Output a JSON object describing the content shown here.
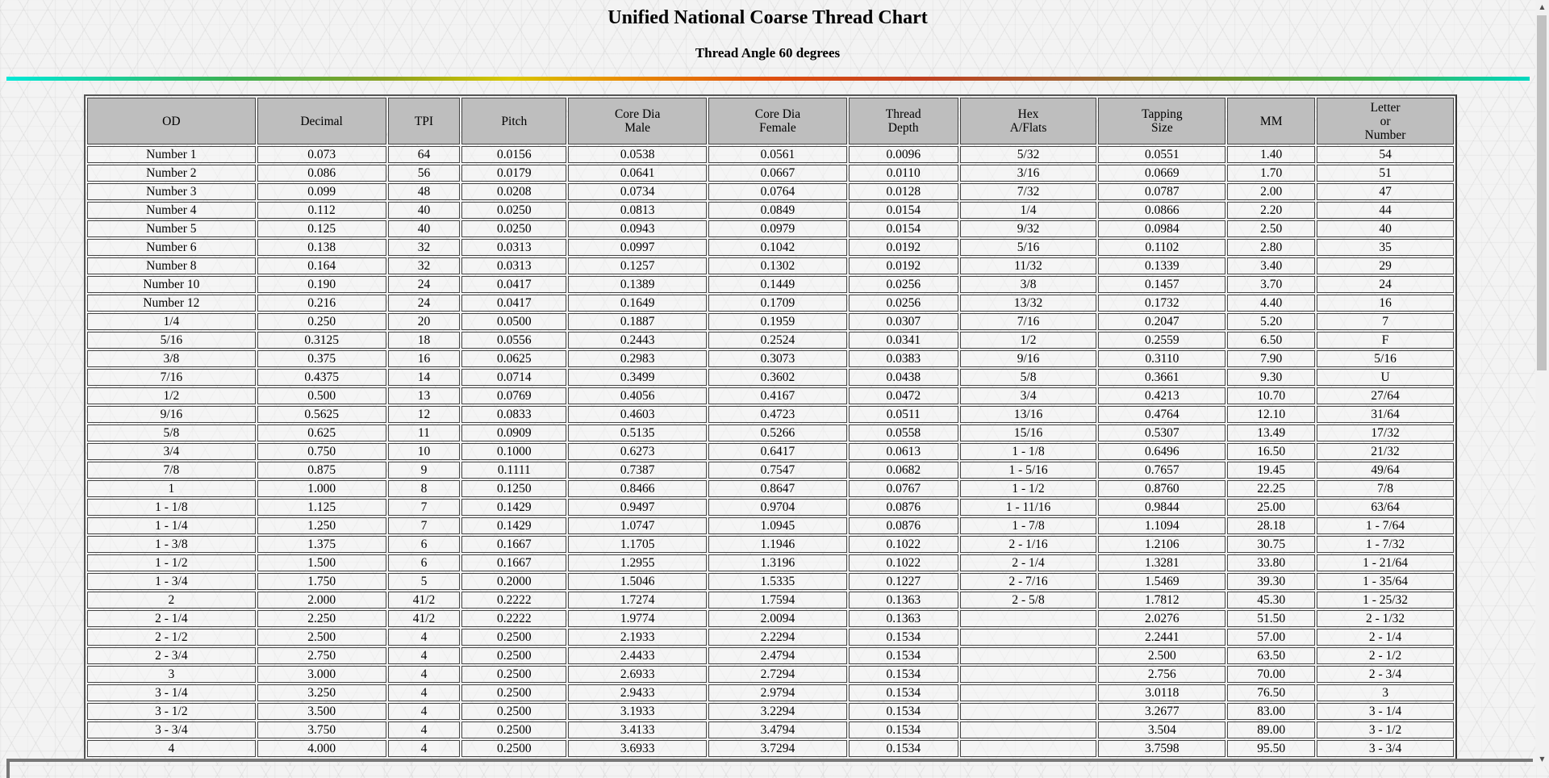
{
  "page": {
    "title": "Unified National Coarse Thread Chart",
    "subtitle": "Thread Angle 60 degrees"
  },
  "table": {
    "headers": [
      [
        "OD"
      ],
      [
        "Decimal"
      ],
      [
        "TPI"
      ],
      [
        "Pitch"
      ],
      [
        "Core Dia",
        "Male"
      ],
      [
        "Core Dia",
        "Female"
      ],
      [
        "Thread",
        "Depth"
      ],
      [
        "Hex",
        "A/Flats"
      ],
      [
        "Tapping",
        "Size"
      ],
      [
        "MM"
      ],
      [
        "Letter",
        "or",
        "Number"
      ]
    ],
    "rows": [
      [
        "Number 1",
        "0.073",
        "64",
        "0.0156",
        "0.0538",
        "0.0561",
        "0.0096",
        "5/32",
        "0.0551",
        "1.40",
        "54"
      ],
      [
        "Number 2",
        "0.086",
        "56",
        "0.0179",
        "0.0641",
        "0.0667",
        "0.0110",
        "3/16",
        "0.0669",
        "1.70",
        "51"
      ],
      [
        "Number 3",
        "0.099",
        "48",
        "0.0208",
        "0.0734",
        "0.0764",
        "0.0128",
        "7/32",
        "0.0787",
        "2.00",
        "47"
      ],
      [
        "Number 4",
        "0.112",
        "40",
        "0.0250",
        "0.0813",
        "0.0849",
        "0.0154",
        "1/4",
        "0.0866",
        "2.20",
        "44"
      ],
      [
        "Number 5",
        "0.125",
        "40",
        "0.0250",
        "0.0943",
        "0.0979",
        "0.0154",
        "9/32",
        "0.0984",
        "2.50",
        "40"
      ],
      [
        "Number 6",
        "0.138",
        "32",
        "0.0313",
        "0.0997",
        "0.1042",
        "0.0192",
        "5/16",
        "0.1102",
        "2.80",
        "35"
      ],
      [
        "Number 8",
        "0.164",
        "32",
        "0.0313",
        "0.1257",
        "0.1302",
        "0.0192",
        "11/32",
        "0.1339",
        "3.40",
        "29"
      ],
      [
        "Number 10",
        "0.190",
        "24",
        "0.0417",
        "0.1389",
        "0.1449",
        "0.0256",
        "3/8",
        "0.1457",
        "3.70",
        "24"
      ],
      [
        "Number 12",
        "0.216",
        "24",
        "0.0417",
        "0.1649",
        "0.1709",
        "0.0256",
        "13/32",
        "0.1732",
        "4.40",
        "16"
      ],
      [
        "1/4",
        "0.250",
        "20",
        "0.0500",
        "0.1887",
        "0.1959",
        "0.0307",
        "7/16",
        "0.2047",
        "5.20",
        "7"
      ],
      [
        "5/16",
        "0.3125",
        "18",
        "0.0556",
        "0.2443",
        "0.2524",
        "0.0341",
        "1/2",
        "0.2559",
        "6.50",
        "F"
      ],
      [
        "3/8",
        "0.375",
        "16",
        "0.0625",
        "0.2983",
        "0.3073",
        "0.0383",
        "9/16",
        "0.3110",
        "7.90",
        "5/16"
      ],
      [
        "7/16",
        "0.4375",
        "14",
        "0.0714",
        "0.3499",
        "0.3602",
        "0.0438",
        "5/8",
        "0.3661",
        "9.30",
        "U"
      ],
      [
        "1/2",
        "0.500",
        "13",
        "0.0769",
        "0.4056",
        "0.4167",
        "0.0472",
        "3/4",
        "0.4213",
        "10.70",
        "27/64"
      ],
      [
        "9/16",
        "0.5625",
        "12",
        "0.0833",
        "0.4603",
        "0.4723",
        "0.0511",
        "13/16",
        "0.4764",
        "12.10",
        "31/64"
      ],
      [
        "5/8",
        "0.625",
        "11",
        "0.0909",
        "0.5135",
        "0.5266",
        "0.0558",
        "15/16",
        "0.5307",
        "13.49",
        "17/32"
      ],
      [
        "3/4",
        "0.750",
        "10",
        "0.1000",
        "0.6273",
        "0.6417",
        "0.0613",
        "1 - 1/8",
        "0.6496",
        "16.50",
        "21/32"
      ],
      [
        "7/8",
        "0.875",
        "9",
        "0.1111",
        "0.7387",
        "0.7547",
        "0.0682",
        "1 - 5/16",
        "0.7657",
        "19.45",
        "49/64"
      ],
      [
        "1",
        "1.000",
        "8",
        "0.1250",
        "0.8466",
        "0.8647",
        "0.0767",
        "1 - 1/2",
        "0.8760",
        "22.25",
        "7/8"
      ],
      [
        "1 - 1/8",
        "1.125",
        "7",
        "0.1429",
        "0.9497",
        "0.9704",
        "0.0876",
        "1 - 11/16",
        "0.9844",
        "25.00",
        "63/64"
      ],
      [
        "1 - 1/4",
        "1.250",
        "7",
        "0.1429",
        "1.0747",
        "1.0945",
        "0.0876",
        "1 - 7/8",
        "1.1094",
        "28.18",
        "1 - 7/64"
      ],
      [
        "1 - 3/8",
        "1.375",
        "6",
        "0.1667",
        "1.1705",
        "1.1946",
        "0.1022",
        "2 - 1/16",
        "1.2106",
        "30.75",
        "1 - 7/32"
      ],
      [
        "1 - 1/2",
        "1.500",
        "6",
        "0.1667",
        "1.2955",
        "1.3196",
        "0.1022",
        "2 - 1/4",
        "1.3281",
        "33.80",
        "1 - 21/64"
      ],
      [
        "1 - 3/4",
        "1.750",
        "5",
        "0.2000",
        "1.5046",
        "1.5335",
        "0.1227",
        "2 - 7/16",
        "1.5469",
        "39.30",
        "1 - 35/64"
      ],
      [
        "2",
        "2.000",
        "41/2",
        "0.2222",
        "1.7274",
        "1.7594",
        "0.1363",
        "2 - 5/8",
        "1.7812",
        "45.30",
        "1 - 25/32"
      ],
      [
        "2 - 1/4",
        "2.250",
        "41/2",
        "0.2222",
        "1.9774",
        "2.0094",
        "0.1363",
        "",
        "2.0276",
        "51.50",
        "2 - 1/32"
      ],
      [
        "2 - 1/2",
        "2.500",
        "4",
        "0.2500",
        "2.1933",
        "2.2294",
        "0.1534",
        "",
        "2.2441",
        "57.00",
        "2 - 1/4"
      ],
      [
        "2 - 3/4",
        "2.750",
        "4",
        "0.2500",
        "2.4433",
        "2.4794",
        "0.1534",
        "",
        "2.500",
        "63.50",
        "2 - 1/2"
      ],
      [
        "3",
        "3.000",
        "4",
        "0.2500",
        "2.6933",
        "2.7294",
        "0.1534",
        "",
        "2.756",
        "70.00",
        "2 - 3/4"
      ],
      [
        "3 - 1/4",
        "3.250",
        "4",
        "0.2500",
        "2.9433",
        "2.9794",
        "0.1534",
        "",
        "3.0118",
        "76.50",
        "3"
      ],
      [
        "3 - 1/2",
        "3.500",
        "4",
        "0.2500",
        "3.1933",
        "3.2294",
        "0.1534",
        "",
        "3.2677",
        "83.00",
        "3 - 1/4"
      ],
      [
        "3 - 3/4",
        "3.750",
        "4",
        "0.2500",
        "3.4133",
        "3.4794",
        "0.1534",
        "",
        "3.504",
        "89.00",
        "3 - 1/2"
      ],
      [
        "4",
        "4.000",
        "4",
        "0.2500",
        "3.6933",
        "3.7294",
        "0.1534",
        "",
        "3.7598",
        "95.50",
        "3 - 3/4"
      ]
    ]
  },
  "scrollbar": {
    "up_icon": "▲",
    "down_icon": "▼"
  }
}
